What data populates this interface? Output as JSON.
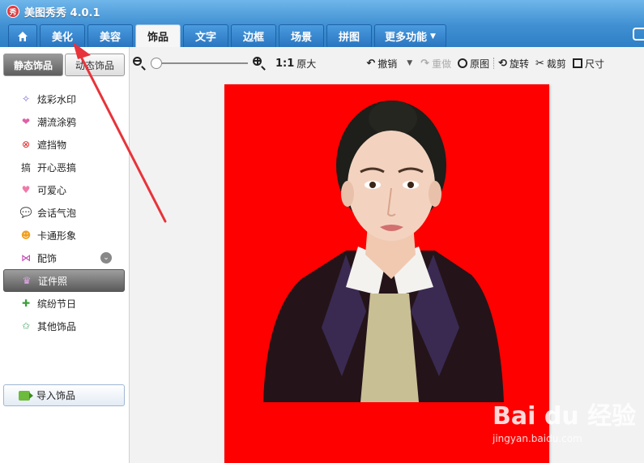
{
  "app": {
    "title": "美图秀秀 4.0.1",
    "logo_text": "秀"
  },
  "tabs": [
    {
      "label": "",
      "icon": "home-icon"
    },
    {
      "label": "美化"
    },
    {
      "label": "美容"
    },
    {
      "label": "饰品",
      "active": true
    },
    {
      "label": "文字"
    },
    {
      "label": "边框"
    },
    {
      "label": "场景"
    },
    {
      "label": "拼图"
    },
    {
      "label": "更多功能",
      "dropdown": true
    }
  ],
  "toolbar": {
    "zoom_ratio": "1:1",
    "original_size": "原大",
    "undo": "撤销",
    "redo": "重做",
    "original": "原图",
    "rotate": "旋转",
    "crop": "裁剪",
    "size": "尺寸"
  },
  "sidebar": {
    "tabs": [
      {
        "label": "静态饰品",
        "active": true
      },
      {
        "label": "动态饰品"
      }
    ],
    "items": [
      {
        "label": "炫彩水印",
        "icon": "sparkle-icon",
        "glyph": "✧",
        "color": "#7d6bd8"
      },
      {
        "label": "潮流涂鸦",
        "icon": "lips-icon",
        "glyph": "❤",
        "color": "#e05fa5"
      },
      {
        "label": "遮挡物",
        "icon": "mask-icon",
        "glyph": "⊗",
        "color": "#d22"
      },
      {
        "label": "开心恶搞",
        "icon": "prank-icon",
        "glyph": "搞",
        "color": "#333"
      },
      {
        "label": "可爱心",
        "icon": "heart-icon",
        "glyph": "♥",
        "color": "#f07aa8"
      },
      {
        "label": "会话气泡",
        "icon": "speech-bubble-icon",
        "glyph": "💬",
        "color": "#d44"
      },
      {
        "label": "卡通形象",
        "icon": "cartoon-icon",
        "glyph": "☻",
        "color": "#f0a020"
      },
      {
        "label": "配饰",
        "icon": "bow-icon",
        "glyph": "⋈",
        "color": "#c23fb2",
        "expandable": true
      },
      {
        "label": "证件照",
        "icon": "id-photo-icon",
        "glyph": "♛",
        "color": "#e0a8e8",
        "selected": true
      },
      {
        "label": "缤纷节日",
        "icon": "gift-icon",
        "glyph": "✚",
        "color": "#3aa03a"
      },
      {
        "label": "其他饰品",
        "icon": "star-icon",
        "glyph": "✩",
        "color": "#3a9c5a"
      }
    ],
    "import_label": "导入饰品"
  },
  "watermark": {
    "brand": "Bai du 经验",
    "url": "jingyan.baidu.com"
  },
  "colors": {
    "photo_background": "#ff0000",
    "accent": "#2f7fc6",
    "arrow": "#e8333a"
  }
}
